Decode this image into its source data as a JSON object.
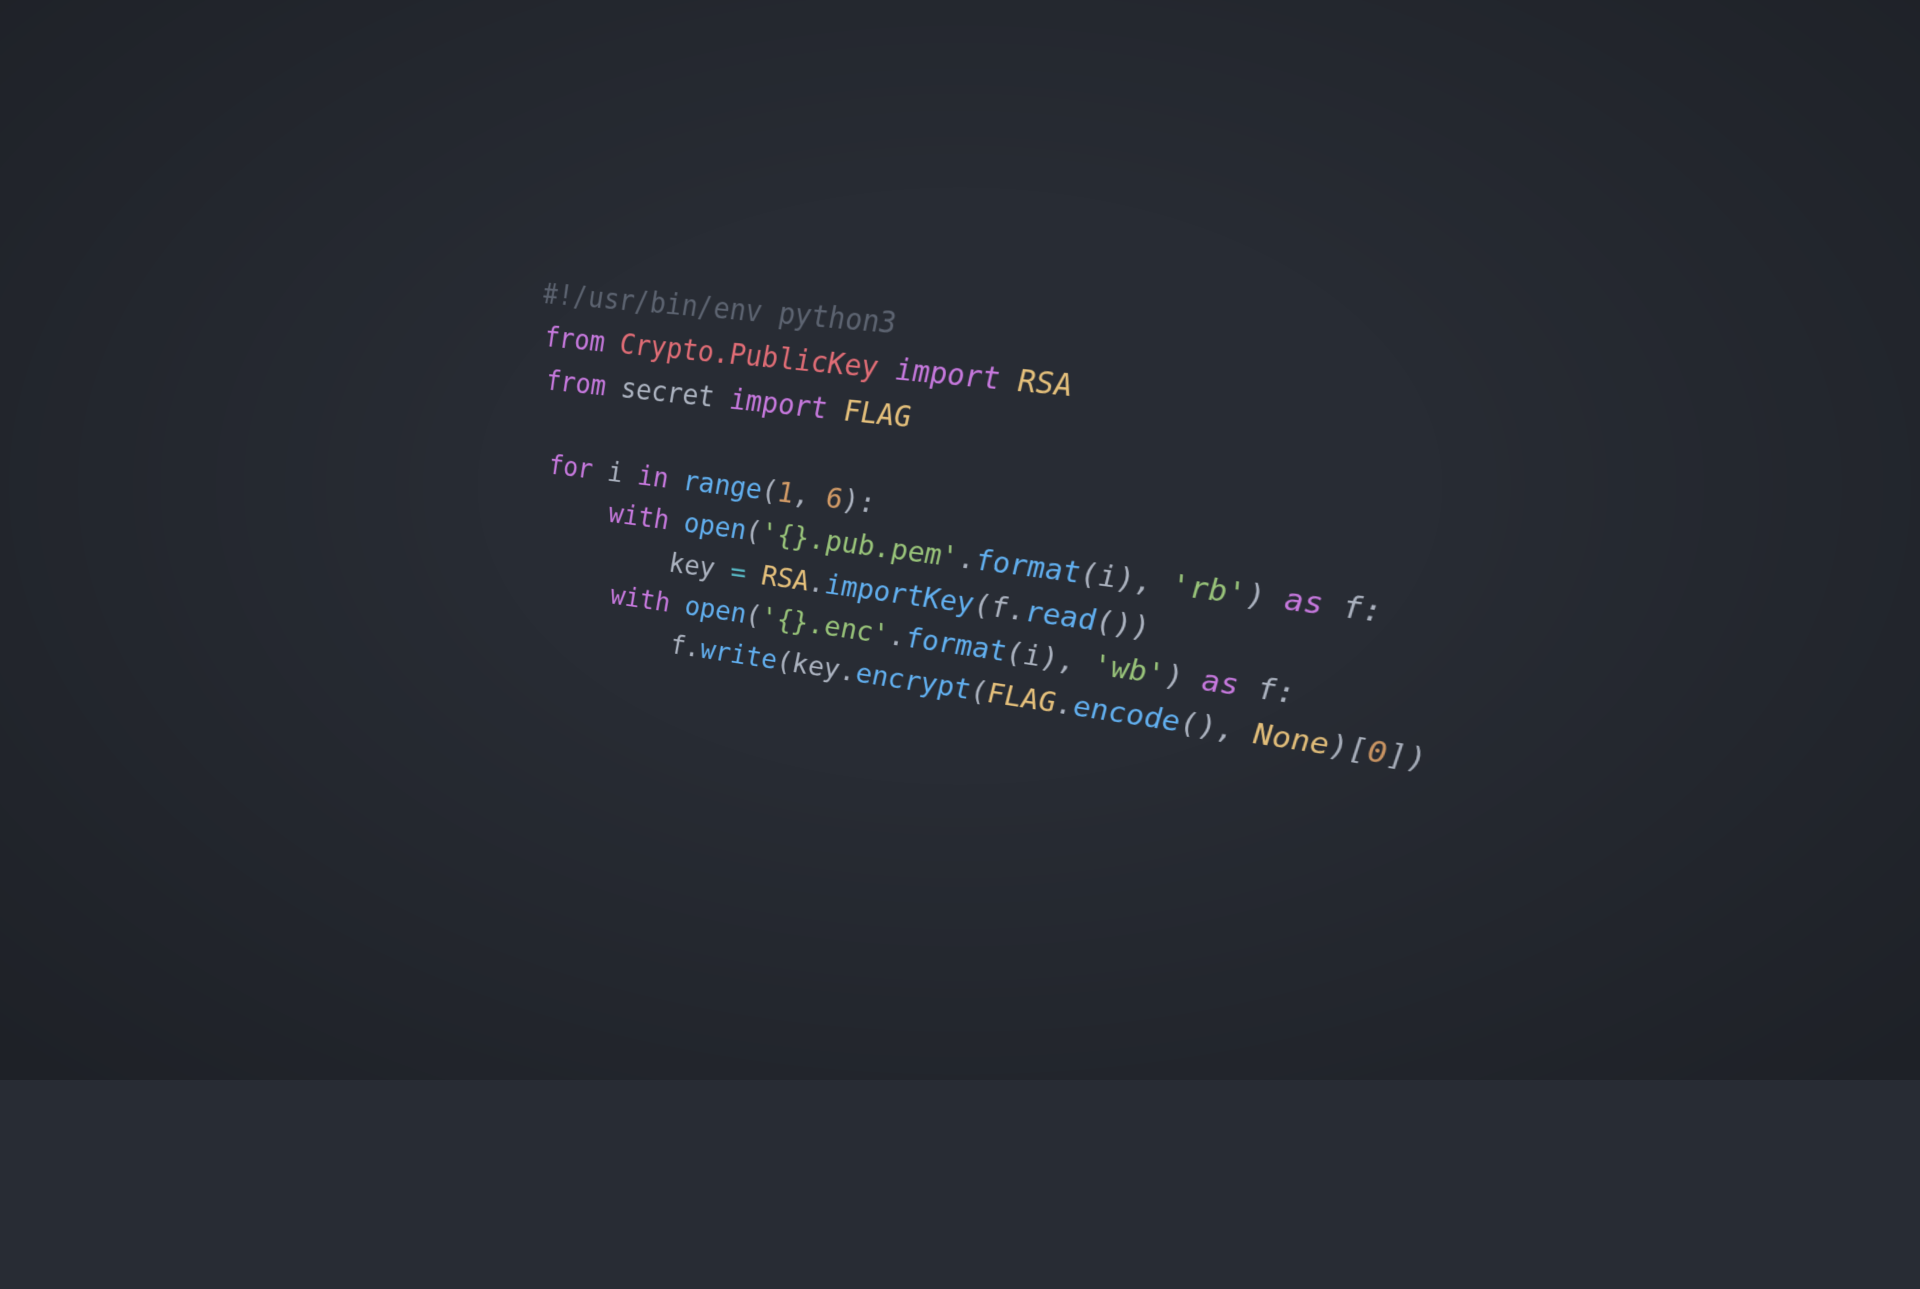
{
  "code": {
    "line1_shebang": "#!/usr/bin/env python3",
    "kw_from": "from",
    "kw_import": "import",
    "kw_for": "for",
    "kw_in": "in",
    "kw_with": "with",
    "kw_as": "as",
    "mod_crypto": "Crypto.PublicKey",
    "mod_secret": "secret",
    "cls_rsa": "RSA",
    "cls_flag": "FLAG",
    "cls_none": "None",
    "id_i": "i",
    "id_f": "f",
    "id_key": "key",
    "fn_range": "range",
    "fn_open": "open",
    "fn_format": "format",
    "fn_importKey": "importKey",
    "fn_read": "read",
    "fn_write": "write",
    "fn_encrypt": "encrypt",
    "fn_encode": "encode",
    "num_1": "1",
    "num_6": "6",
    "num_0": "0",
    "str_pubpem": "'{}.pub.pem'",
    "str_rb": "'rb'",
    "str_enc": "'{}.enc'",
    "str_wb": "'wb'",
    "p_dot": ".",
    "p_comma": ", ",
    "p_colon": ":",
    "p_lparen": "(",
    "p_rparen": ")",
    "p_lbrack": "[",
    "p_rbrack": "]",
    "op_eq": " = "
  }
}
